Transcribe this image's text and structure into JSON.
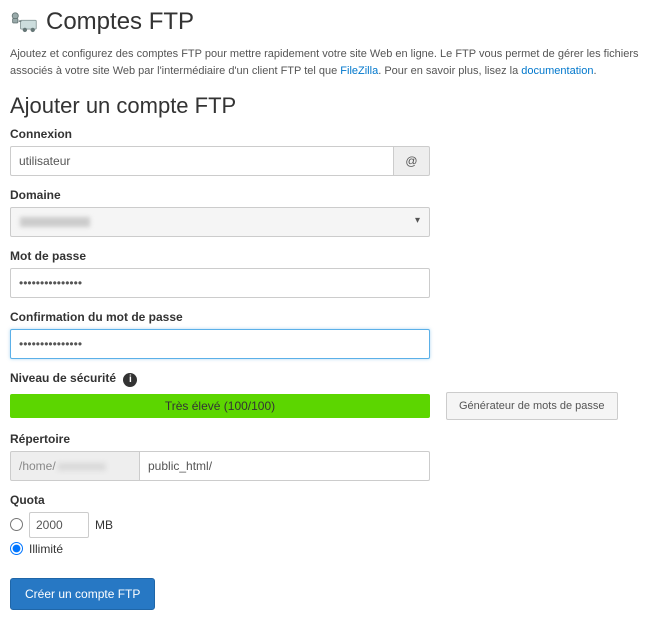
{
  "page": {
    "title": "Comptes FTP",
    "intro_before": "Ajoutez et configurez des comptes FTP pour mettre rapidement votre site Web en ligne. Le FTP vous permet de gérer les fichiers associés à votre site Web par l'intermédiaire d'un client FTP tel que ",
    "link_filezilla": "FileZilla",
    "intro_mid": ". Pour en savoir plus, lisez la ",
    "link_docs": "documentation",
    "intro_end": "."
  },
  "form": {
    "heading": "Ajouter un compte FTP",
    "login_label": "Connexion",
    "login_value": "utilisateur",
    "at_symbol": "@",
    "domain_label": "Domaine",
    "password_label": "Mot de passe",
    "password_value": "•••••••••••••••",
    "confirm_label": "Confirmation du mot de passe",
    "confirm_value": "•••••••••••••••",
    "security_label": "Niveau de sécurité",
    "strength_text": "Très élevé (100/100)",
    "generator_btn": "Générateur de mots de passe",
    "directory_label": "Répertoire",
    "dir_prefix": "/home/",
    "dir_value": "public_html/",
    "quota_label": "Quota",
    "quota_value": "2000",
    "quota_unit": "MB",
    "quota_unlimited": "Illimité",
    "submit": "Créer un compte FTP"
  }
}
